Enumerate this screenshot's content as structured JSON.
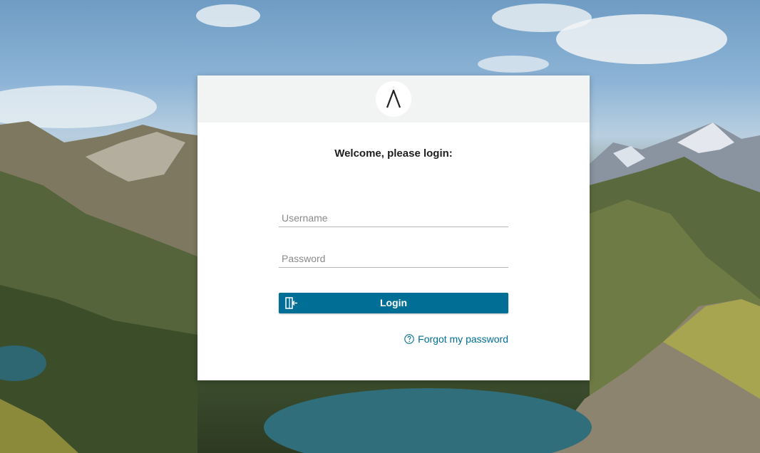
{
  "header": {
    "logo_icon": "lambda-logo-icon"
  },
  "login": {
    "title": "Welcome, please login:",
    "username_placeholder": "Username",
    "username_value": "",
    "password_placeholder": "Password",
    "password_value": "",
    "login_button_label": "Login",
    "login_button_icon": "login-door-icon",
    "forgot_link_label": "Forgot my password",
    "forgot_link_icon": "help-circle-icon"
  },
  "colors": {
    "accent": "#006e95",
    "header_bg": "#f2f4f3",
    "card_bg": "#ffffff"
  },
  "background": {
    "description_icon": "mountain-lake-background"
  }
}
